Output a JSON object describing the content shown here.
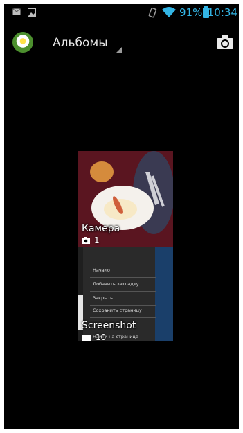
{
  "status_bar": {
    "battery_percent": "91%",
    "time": "10:34",
    "left_icons": [
      "mail-icon",
      "image-icon"
    ],
    "right_icons": [
      "rotate-icon",
      "wifi-icon",
      "battery-icon"
    ],
    "accent_color": "#33b5e5"
  },
  "action_bar": {
    "title": "Альбомы",
    "app_icon": "daisy-icon",
    "camera_button_icon": "camera-icon"
  },
  "albums": [
    {
      "label": "Камера",
      "count": "1",
      "type_icon": "camera-icon"
    },
    {
      "label": "Screenshot",
      "count": "10",
      "type_icon": "folder-icon"
    }
  ],
  "screenshot_thumbnail_menu": [
    "Начало",
    "Добавить закладку",
    "Закрыть",
    "Сохранить страницу",
    "Найти на странице"
  ]
}
